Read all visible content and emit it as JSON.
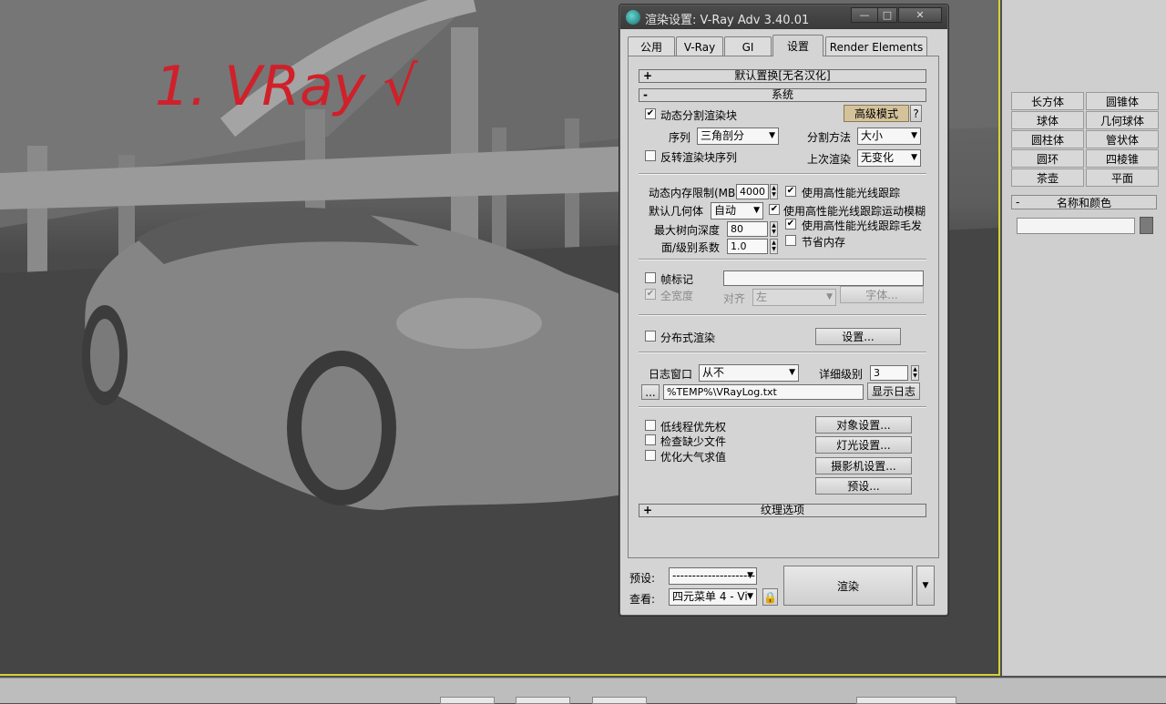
{
  "dialog": {
    "title": "渲染设置: V-Ray Adv 3.40.01",
    "win_buttons": [
      "—",
      "□",
      "✕"
    ],
    "tabs": [
      "公用",
      "V-Ray",
      "GI",
      "设置",
      "Render Elements"
    ],
    "active_tab": "设置"
  },
  "rollouts": {
    "default_displacement": "默认置换[无名汉化]",
    "system": "系统",
    "texture_options": "纹理选项",
    "plus_sign": "+",
    "minus_sign": "-"
  },
  "system": {
    "dynamic_split_label": "动态分割渲染块",
    "dynamic_split_checked": "✔",
    "mode_button": "高级模式",
    "help_button": "?",
    "sequence_label": "序列",
    "sequence_value": "三角剖分",
    "split_method_label": "分割方法",
    "split_method_value": "大小",
    "reverse_label": "反转渲染块序列",
    "previous_render_label": "上次渲染",
    "previous_render_value": "无变化",
    "mem_limit_label": "动态内存限制(MB)",
    "mem_limit_value": "4000",
    "default_geometry_label": "默认几何体",
    "default_geometry_value": "自动",
    "max_tree_depth_label": "最大树向深度",
    "max_tree_depth_value": "80",
    "face_level_label": "面/级别系数",
    "face_level_value": "1.0",
    "embree_label": "使用高性能光线跟踪",
    "embree_motion_label": "使用高性能光线跟踪运动模糊",
    "embree_hair_label": "使用高性能光线跟踪毛发",
    "conserve_memory_label": "节省内存",
    "frame_stamp_label": "帧标记",
    "full_width_label": "全宽度",
    "justify_label": "对齐",
    "justify_value": "左",
    "font_button": "字体...",
    "distributed_label": "分布式渲染",
    "distributed_settings_button": "设置...",
    "log_window_label": "日志窗口",
    "log_window_value": "从不",
    "verbose_label": "详细级别",
    "verbose_value": "3",
    "log_browse_button": "...",
    "log_path": "%TEMP%\\VRayLog.txt",
    "show_log_button": "显示日志",
    "low_thread_label": "低线程优先权",
    "check_missing_label": "检查缺少文件",
    "optimize_atmo_label": "优化大气求值",
    "object_settings_button": "对象设置...",
    "light_settings_button": "灯光设置...",
    "camera_settings_button": "摄影机设置...",
    "presets_button": "预设..."
  },
  "bottom": {
    "preset_label": "预设:",
    "preset_value": "---------------------",
    "view_label": "查看:",
    "view_value": "四元菜单 4 - Vi",
    "render_button": "渲染",
    "lock_icon": "lock-icon"
  },
  "command_panel": {
    "primitives": [
      "长方体",
      "圆锥体",
      "球体",
      "几何球体",
      "圆柱体",
      "管状体",
      "圆环",
      "四棱锥",
      "茶壶",
      "平面"
    ],
    "name_color_title": "名称和颜色"
  },
  "viewport": {
    "annotation": "1. VRay √"
  },
  "colors": {
    "viewport_border": "#d6d03a",
    "title_bar": "#3f3f3f",
    "mode_button": "#d4c29a",
    "annotation": "#d0202a"
  }
}
